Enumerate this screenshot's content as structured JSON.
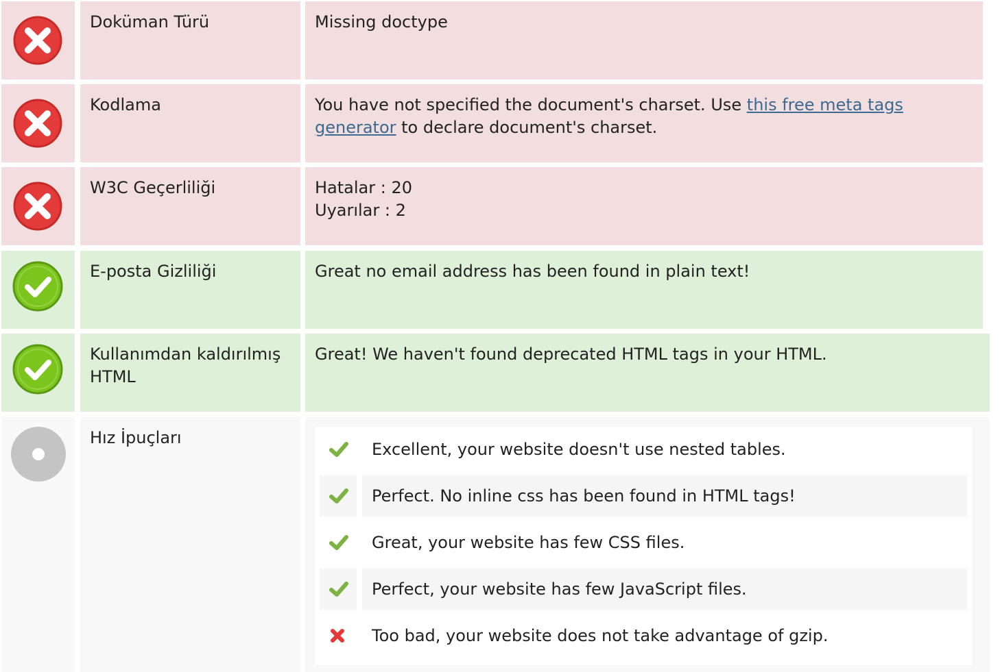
{
  "colors": {
    "error_bg": "#f2dede",
    "success_bg": "#dff0d8",
    "neutral_bg": "#f8f8f8",
    "error_icon": "#e33a3a",
    "success_icon": "#7cc41e",
    "neutral_icon": "#c4c4c4",
    "link": "#3d6a92"
  },
  "rows": [
    {
      "status": "error",
      "icon": "x-circle-icon",
      "label": "Doküman Türü",
      "value": "Missing doctype"
    },
    {
      "status": "error",
      "icon": "x-circle-icon",
      "label": "Kodlama",
      "value_before": "You have not specified the document's charset. Use ",
      "link_text": "this free meta tags generator",
      "value_after": " to declare document's charset."
    },
    {
      "status": "error",
      "icon": "x-circle-icon",
      "label": "W3C Geçerliliği",
      "errors": "Hatalar : 20",
      "warnings": "Uyarılar : 2"
    },
    {
      "status": "success",
      "icon": "check-circle-icon",
      "label": "E-posta Gizliliği",
      "value": "Great no email address has been found in plain text!"
    },
    {
      "status": "success",
      "icon": "check-circle-icon",
      "label": "Kullanımdan kaldırılmış HTML",
      "value": "Great! We haven't found deprecated HTML tags in your HTML."
    },
    {
      "status": "neutral",
      "icon": "info-circle-icon",
      "label": "Hız İpuçları",
      "tips": [
        {
          "icon": "check-icon",
          "text": "Excellent, your website doesn't use nested tables."
        },
        {
          "icon": "check-icon",
          "text": "Perfect. No inline css has been found in HTML tags!"
        },
        {
          "icon": "check-icon",
          "text": "Great, your website has few CSS files."
        },
        {
          "icon": "check-icon",
          "text": "Perfect, your website has few JavaScript files."
        },
        {
          "icon": "cross-icon",
          "text": "Too bad, your website does not take advantage of gzip."
        }
      ]
    }
  ]
}
